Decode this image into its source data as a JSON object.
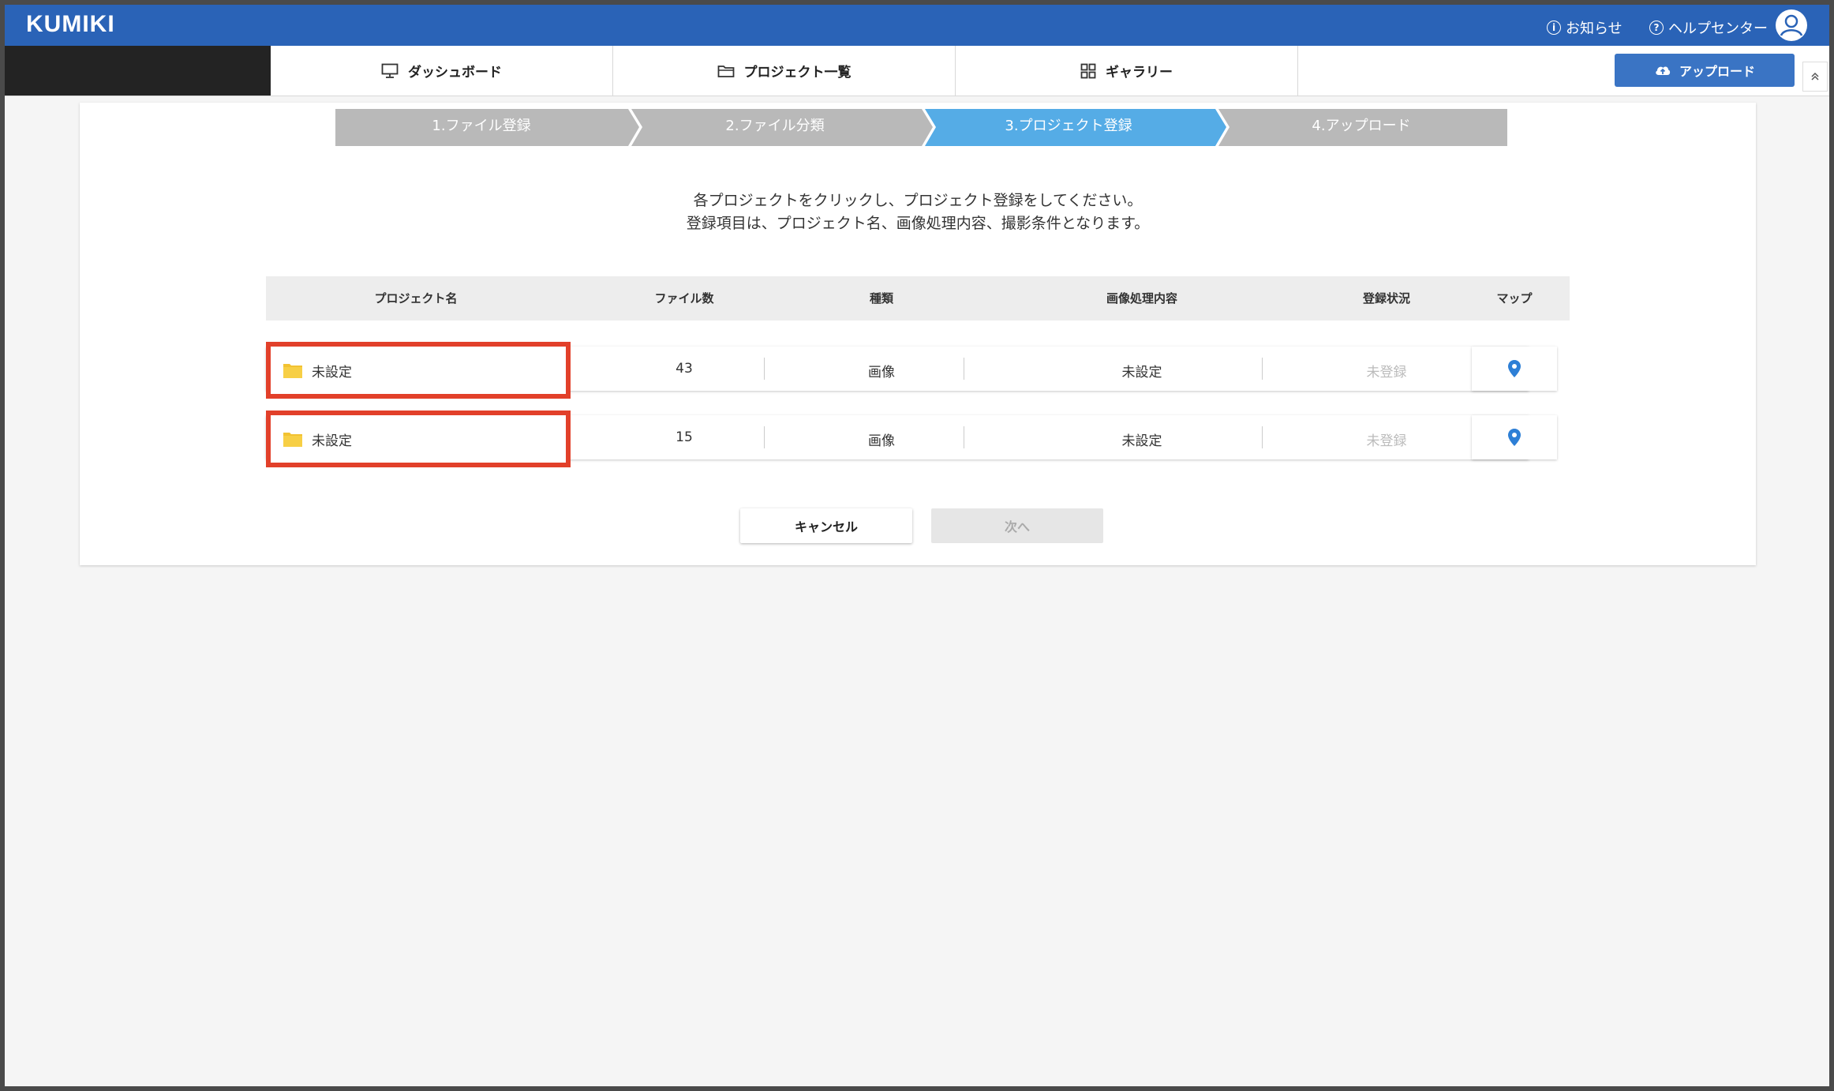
{
  "app": {
    "logo": "KUMIKI"
  },
  "header": {
    "notice_label": "お知らせ",
    "help_label": "ヘルプセンター"
  },
  "nav": {
    "tabs": [
      {
        "label": "ダッシュボード",
        "icon": "monitor-icon"
      },
      {
        "label": "プロジェクト一覧",
        "icon": "folder-icon"
      },
      {
        "label": "ギャラリー",
        "icon": "grid-icon"
      }
    ],
    "upload_label": "アップロード"
  },
  "steps": [
    {
      "label": "1.ファイル登録",
      "state": "done"
    },
    {
      "label": "2.ファイル分類",
      "state": "done"
    },
    {
      "label": "3.プロジェクト登録",
      "state": "active"
    },
    {
      "label": "4.アップロード",
      "state": "pending"
    }
  ],
  "colors": {
    "step_active": "#55ace6",
    "step_inactive": "#b9b9b9",
    "highlight": "#e2402a",
    "brand": "#2a63b7"
  },
  "instructions": {
    "line1": "各プロジェクトをクリックし、プロジェクト登録をしてください。",
    "line2": "登録項目は、プロジェクト名、画像処理内容、撮影条件となります。"
  },
  "table": {
    "headers": {
      "name": "プロジェクト名",
      "files": "ファイル数",
      "type": "種類",
      "processing": "画像処理内容",
      "status": "登録状況",
      "map": "マップ"
    },
    "rows": [
      {
        "name": "未設定",
        "files": "43",
        "type": "画像",
        "processing": "未設定",
        "status": "未登録"
      },
      {
        "name": "未設定",
        "files": "15",
        "type": "画像",
        "processing": "未設定",
        "status": "未登録"
      }
    ]
  },
  "buttons": {
    "cancel": "キャンセル",
    "next": "次へ"
  }
}
